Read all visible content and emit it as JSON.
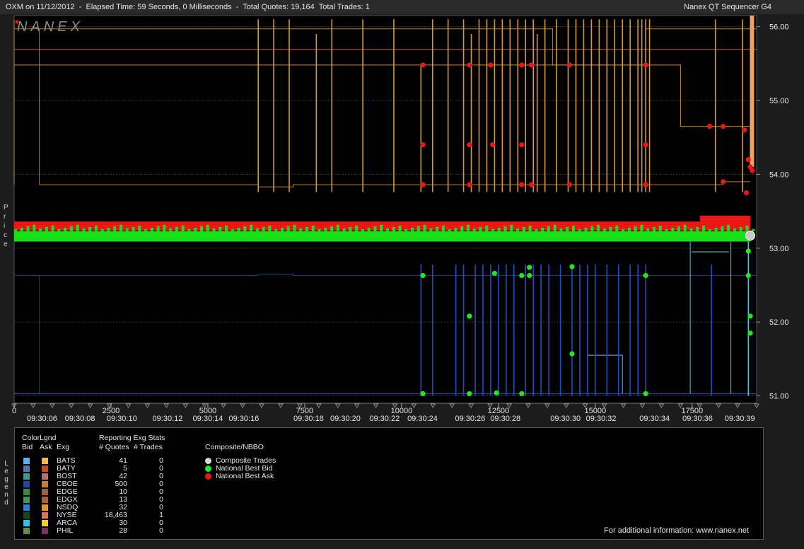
{
  "window": {
    "title_left": "OXM on 11/12/2012  -  Elapsed Time: 59 Seconds, 0 Milliseconds  -  Total Quotes: 19,164  Total Trades: 1",
    "title_right": "Nanex QT Sequencer G4"
  },
  "chart_data": {
    "type": "line",
    "watermark": "NANEX",
    "ylabel": "Price",
    "ylim": [
      50.9,
      56.15
    ],
    "y_ticks": [
      "51.00",
      "52.00",
      "53.00",
      "54.00",
      "55.00",
      "56.00"
    ],
    "xlim": [
      0,
      19164
    ],
    "x_ticks": [
      0,
      2500,
      5000,
      7500,
      10000,
      12500,
      15000,
      17500
    ],
    "time_ticks": [
      {
        "seq": 720,
        "label": "09:30:06"
      },
      {
        "seq": 1700,
        "label": "09:30:08"
      },
      {
        "seq": 2780,
        "label": "09:30:10"
      },
      {
        "seq": 3960,
        "label": "09:30:12"
      },
      {
        "seq": 5000,
        "label": "09:30:14"
      },
      {
        "seq": 5930,
        "label": "09:30:16"
      },
      {
        "seq": 7600,
        "label": "09:30:18"
      },
      {
        "seq": 8550,
        "label": "09:30:20"
      },
      {
        "seq": 9560,
        "label": "09:30:22"
      },
      {
        "seq": 10540,
        "label": "09:30:24"
      },
      {
        "seq": 11770,
        "label": "09:30:26"
      },
      {
        "seq": 12680,
        "label": "09:30:28"
      },
      {
        "seq": 14230,
        "label": "09:30:30"
      },
      {
        "seq": 15150,
        "label": "09:30:32"
      },
      {
        "seq": 16530,
        "label": "09:30:34"
      },
      {
        "seq": 17640,
        "label": "09:30:36"
      },
      {
        "seq": 18730,
        "label": "09:30:39"
      }
    ],
    "nbbo": {
      "bid_level": 53.16,
      "ask_level": 53.3,
      "ask_level_late": 53.38,
      "late_start": 17700
    },
    "ask_levels": [
      {
        "color": "#b88527",
        "points": [
          [
            0,
            55.97
          ],
          [
            13900,
            55.97
          ],
          [
            13900,
            55.48
          ],
          [
            16300,
            55.48
          ],
          [
            16300,
            55.97
          ],
          [
            19164,
            55.97
          ]
        ]
      },
      {
        "color": "#c86a5a",
        "points": [
          [
            0,
            55.69
          ],
          [
            19164,
            55.69
          ]
        ]
      },
      {
        "color": "#c88a2a",
        "points": [
          [
            0,
            55.48
          ],
          [
            17200,
            55.48
          ],
          [
            17200,
            54.65
          ],
          [
            19000,
            54.65
          ]
        ]
      },
      {
        "color": "#b87a28",
        "points": [
          [
            650,
            53.86
          ],
          [
            6300,
            53.86
          ],
          [
            6300,
            53.83
          ],
          [
            7200,
            53.83
          ],
          [
            7200,
            53.86
          ],
          [
            18300,
            53.86
          ],
          [
            18300,
            53.9
          ],
          [
            19000,
            53.9
          ]
        ]
      }
    ],
    "ask_spikes": [
      {
        "x": 6300,
        "top": 56.1
      },
      {
        "x": 6700,
        "top": 56.1
      },
      {
        "x": 7100,
        "top": 56.1
      },
      {
        "x": 7800,
        "top": 55.9
      },
      {
        "x": 8200,
        "top": 56.1
      },
      {
        "x": 9000,
        "top": 56.1
      },
      {
        "x": 9800,
        "top": 56.1
      },
      {
        "x": 10500,
        "top": 55.48
      },
      {
        "x": 10800,
        "top": 56.1
      },
      {
        "x": 11200,
        "top": 56.1
      },
      {
        "x": 11600,
        "top": 56.1
      },
      {
        "x": 11800,
        "top": 55.9
      },
      {
        "x": 12000,
        "top": 56.1
      },
      {
        "x": 12200,
        "top": 56.1
      },
      {
        "x": 12400,
        "top": 56.1
      },
      {
        "x": 12600,
        "top": 56.1
      },
      {
        "x": 12800,
        "top": 56.1
      },
      {
        "x": 13000,
        "top": 56.1
      },
      {
        "x": 13200,
        "top": 56.1
      },
      {
        "x": 13400,
        "top": 56.1
      },
      {
        "x": 13500,
        "top": 55.9
      },
      {
        "x": 13700,
        "top": 56.1
      },
      {
        "x": 14000,
        "top": 56.1
      },
      {
        "x": 14300,
        "top": 56.1
      },
      {
        "x": 14500,
        "top": 56.1
      },
      {
        "x": 14700,
        "top": 56.1
      },
      {
        "x": 14900,
        "top": 56.1
      },
      {
        "x": 15100,
        "top": 56.1
      },
      {
        "x": 15300,
        "top": 56.1
      },
      {
        "x": 15500,
        "top": 56.1
      },
      {
        "x": 15700,
        "top": 56.1
      },
      {
        "x": 15900,
        "top": 56.1
      },
      {
        "x": 16100,
        "top": 56.1
      },
      {
        "x": 16200,
        "top": 56.1
      },
      {
        "x": 16300,
        "top": 56.1
      },
      {
        "x": 16400,
        "top": 56.1
      },
      {
        "x": 18100,
        "top": 56.1
      },
      {
        "x": 18800,
        "top": 56.1
      }
    ],
    "bid_levels": [
      {
        "color": "#1e3f8c",
        "points": [
          [
            0,
            52.63
          ],
          [
            6300,
            52.63
          ],
          [
            6300,
            52.65
          ],
          [
            7200,
            52.65
          ],
          [
            7200,
            52.63
          ],
          [
            19164,
            52.63
          ]
        ]
      },
      {
        "color": "#2a58b8",
        "points": [
          [
            0,
            51.03
          ],
          [
            19164,
            51.03
          ]
        ]
      },
      {
        "color": "#7fb3e6",
        "points": [
          [
            14800,
            51.03
          ],
          [
            14800,
            51.55
          ],
          [
            15700,
            51.55
          ],
          [
            15700,
            51.03
          ]
        ]
      },
      {
        "color": "#56c8e8",
        "points": [
          [
            17450,
            51.03
          ],
          [
            17450,
            53.12
          ],
          [
            18500,
            53.12
          ],
          [
            18500,
            51.03
          ]
        ]
      },
      {
        "color": "#40d8c0",
        "points": [
          [
            17480,
            52.95
          ],
          [
            18450,
            52.95
          ]
        ]
      }
    ],
    "bid_spikes": [
      {
        "x": 10500,
        "bottom": 51.0
      },
      {
        "x": 10800,
        "bottom": 51.0
      },
      {
        "x": 11400,
        "bottom": 51.0
      },
      {
        "x": 11600,
        "bottom": 51.0
      },
      {
        "x": 11900,
        "bottom": 51.0
      },
      {
        "x": 12100,
        "bottom": 51.0
      },
      {
        "x": 12300,
        "bottom": 51.0
      },
      {
        "x": 12500,
        "bottom": 51.0
      },
      {
        "x": 12700,
        "bottom": 51.0
      },
      {
        "x": 12900,
        "bottom": 51.0
      },
      {
        "x": 13200,
        "bottom": 51.0
      },
      {
        "x": 13400,
        "bottom": 51.0
      },
      {
        "x": 13600,
        "bottom": 51.0
      },
      {
        "x": 13800,
        "bottom": 51.0
      },
      {
        "x": 14100,
        "bottom": 51.0
      },
      {
        "x": 14400,
        "bottom": 51.0
      },
      {
        "x": 14600,
        "bottom": 51.0
      },
      {
        "x": 14800,
        "bottom": 51.0
      },
      {
        "x": 15000,
        "bottom": 51.0
      },
      {
        "x": 15300,
        "bottom": 51.0
      },
      {
        "x": 15600,
        "bottom": 51.0
      },
      {
        "x": 15900,
        "bottom": 51.0
      },
      {
        "x": 16100,
        "bottom": 51.0
      },
      {
        "x": 16300,
        "bottom": 51.0
      },
      {
        "x": 18000,
        "bottom": 51.0
      }
    ],
    "nbo_points": [
      [
        10550,
        55.48
      ],
      [
        10550,
        54.4
      ],
      [
        10550,
        53.86
      ],
      [
        11750,
        55.48
      ],
      [
        11750,
        54.4
      ],
      [
        11750,
        53.86
      ],
      [
        12300,
        55.48
      ],
      [
        12350,
        54.4
      ],
      [
        13100,
        55.48
      ],
      [
        13100,
        54.4
      ],
      [
        13100,
        53.86
      ],
      [
        13350,
        55.48
      ],
      [
        13350,
        53.86
      ],
      [
        14330,
        55.48
      ],
      [
        14330,
        53.86
      ],
      [
        16300,
        55.48
      ],
      [
        16300,
        54.4
      ],
      [
        16300,
        53.86
      ],
      [
        17950,
        54.65
      ],
      [
        18300,
        54.65
      ],
      [
        18300,
        53.9
      ],
      [
        18850,
        54.6
      ],
      [
        18900,
        53.75
      ],
      [
        18950,
        54.2
      ],
      [
        19000,
        54.1
      ],
      [
        19050,
        54.05
      ]
    ],
    "nbb_points": [
      [
        10550,
        52.63
      ],
      [
        10550,
        51.03
      ],
      [
        11750,
        52.08
      ],
      [
        11750,
        51.03
      ],
      [
        12400,
        52.66
      ],
      [
        12450,
        51.04
      ],
      [
        13100,
        52.63
      ],
      [
        13100,
        51.03
      ],
      [
        13300,
        52.74
      ],
      [
        13300,
        52.63
      ],
      [
        14400,
        52.75
      ],
      [
        14400,
        51.57
      ],
      [
        16300,
        52.63
      ],
      [
        16300,
        51.03
      ],
      [
        18950,
        52.96
      ],
      [
        18950,
        52.63
      ],
      [
        19000,
        52.08
      ],
      [
        19000,
        51.85
      ]
    ],
    "trades": [
      [
        19000,
        53.17
      ]
    ]
  },
  "legend": {
    "side_label": "Legend",
    "color_lgnd_title": "ColorLgnd",
    "col_bid": "Bid",
    "col_ask": "Ask",
    "col_exg": "Exg",
    "stats_title": "Reporting Exg Stats",
    "col_quotes": "# Quotes",
    "col_trades": "# Trades",
    "composite_title": "Composite/NBBO",
    "exchanges": [
      {
        "name": "BATS",
        "quotes": "41",
        "trades": "0",
        "bid_color": "#5ab0e8",
        "ask_color": "#f0b850"
      },
      {
        "name": "BATY",
        "quotes": "5",
        "trades": "0",
        "bid_color": "#4a78b0",
        "ask_color": "#c84820"
      },
      {
        "name": "BOST",
        "quotes": "42",
        "trades": "0",
        "bid_color": "#3a9a8a",
        "ask_color": "#b87060"
      },
      {
        "name": "CBOE",
        "quotes": "500",
        "trades": "0",
        "bid_color": "#1e48b0",
        "ask_color": "#c88030"
      },
      {
        "name": "EDGE",
        "quotes": "10",
        "trades": "0",
        "bid_color": "#3a8a40",
        "ask_color": "#a06040"
      },
      {
        "name": "EDGX",
        "quotes": "13",
        "trades": "0",
        "bid_color": "#3a9a60",
        "ask_color": "#b06030"
      },
      {
        "name": "NSDQ",
        "quotes": "32",
        "trades": "0",
        "bid_color": "#2080e0",
        "ask_color": "#e89020"
      },
      {
        "name": "NYSE",
        "quotes": "18,463",
        "trades": "1",
        "bid_color": "#104a20",
        "ask_color": "#e07060"
      },
      {
        "name": "ARCA",
        "quotes": "30",
        "trades": "0",
        "bid_color": "#20c8f0",
        "ask_color": "#f0d020"
      },
      {
        "name": "PHIL",
        "quotes": "28",
        "trades": "0",
        "bid_color": "#609040",
        "ask_color": "#803060"
      }
    ],
    "composite": [
      {
        "label": "Composite Trades",
        "color": "#d8d8d8"
      },
      {
        "label": "National Best Bid",
        "color": "#22e822"
      },
      {
        "label": "National Best Ask",
        "color": "#e81818"
      }
    ],
    "footer": "For additional information: www.nanex.net"
  }
}
